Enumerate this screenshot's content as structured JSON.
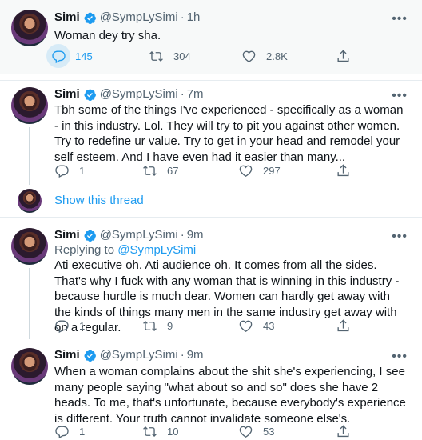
{
  "tweets": [
    {
      "name": "Simi",
      "handle": "@SympLySimi",
      "time": "1h",
      "text": "Woman dey try sha.",
      "replies": "145",
      "retweets": "304",
      "likes": "2.8K"
    },
    {
      "name": "Simi",
      "handle": "@SympLySimi",
      "time": "7m",
      "text": "Tbh some of the things I've experienced  - specifically as a woman - in this industry. Lol. They will try to pit you against other women. Try to redefine ur value. Try to get in your head and remodel your self esteem. And I have even had it easier than many...",
      "replies": "1",
      "retweets": "67",
      "likes": "297"
    },
    {
      "name": "Simi",
      "handle": "@SympLySimi",
      "time": "9m",
      "replying_prefix": "Replying to ",
      "replying_to": "@SympLySimi",
      "text": "Ati executive oh. Ati audience oh. It comes from all the sides. That's why I fuck with any woman that is winning in this industry - because hurdle is much dear. Women can hardly get away with the kinds of things many men in the same industry get away with on a regular.",
      "replies": "1",
      "retweets": "9",
      "likes": "43"
    },
    {
      "name": "Simi",
      "handle": "@SympLySimi",
      "time": "9m",
      "text": "When a woman complains about the shit she's experiencing, I see many people saying \"what about so and so\" does she have 2 heads. To me, that's unfortunate, because everybody's experience is different. Your truth cannot invalidate someone else's.",
      "replies": "1",
      "retweets": "10",
      "likes": "53"
    }
  ],
  "show_thread": "Show this thread",
  "more_label": "•••",
  "dot": "·",
  "icons": [
    "verified-badge-icon",
    "reply-icon",
    "retweet-icon",
    "like-icon",
    "share-icon",
    "more-icon"
  ],
  "colors": {
    "accent": "#1d9bf0",
    "muted": "#536471",
    "highlight": "#f7f9f9"
  }
}
